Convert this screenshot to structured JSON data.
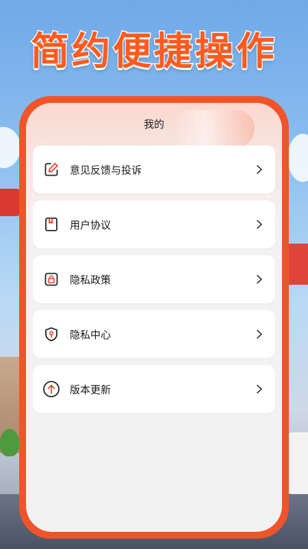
{
  "headline": "简约便捷操作",
  "screen": {
    "title": "我的"
  },
  "menu": {
    "items": [
      {
        "label": "意见反馈与投诉",
        "icon": "edit-icon"
      },
      {
        "label": "用户协议",
        "icon": "book-icon"
      },
      {
        "label": "隐私政策",
        "icon": "lock-icon"
      },
      {
        "label": "隐私中心",
        "icon": "shield-icon"
      },
      {
        "label": "版本更新",
        "icon": "arrow-up-circle-icon"
      }
    ]
  },
  "colors": {
    "accent": "#f0542a",
    "headline": "#ff5a1f",
    "icon_accent": "#e8432b"
  }
}
